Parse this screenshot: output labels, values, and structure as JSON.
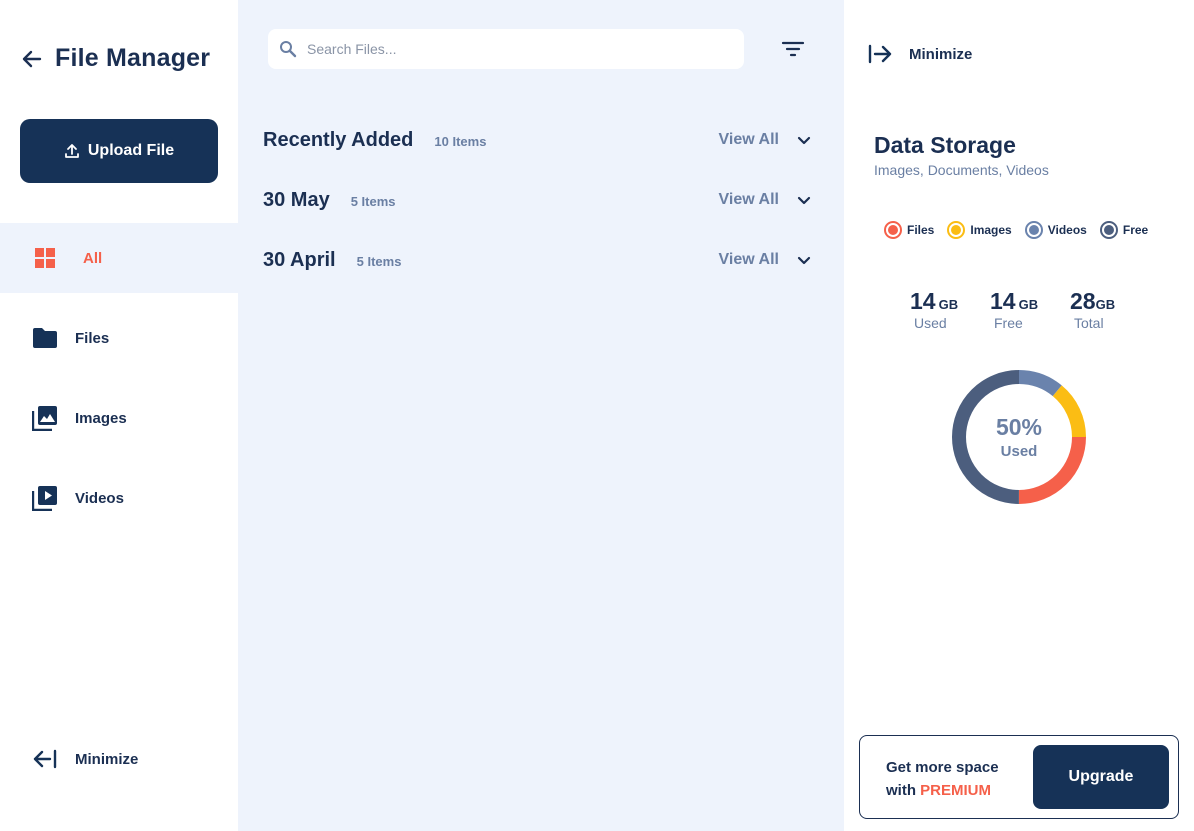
{
  "sidebar": {
    "title": "File Manager",
    "upload_label": "Upload File",
    "items": [
      {
        "label": "All",
        "icon": "grid-icon",
        "active": true
      },
      {
        "label": "Files",
        "icon": "folder-icon",
        "active": false
      },
      {
        "label": "Images",
        "icon": "images-icon",
        "active": false
      },
      {
        "label": "Videos",
        "icon": "video-library-icon",
        "active": false
      }
    ],
    "minimize_label": "Minimize"
  },
  "main": {
    "search_placeholder": "Search Files...",
    "sections": [
      {
        "title": "Recently Added",
        "count": "10 Items",
        "view_all": "View All"
      },
      {
        "title": "30 May",
        "count": "5 Items",
        "view_all": "View All"
      },
      {
        "title": "30 April",
        "count": "5 Items",
        "view_all": "View All"
      }
    ]
  },
  "right_panel": {
    "minimize_label": "Minimize",
    "storage_title": "Data Storage",
    "storage_subtitle": "Images, Documents, Videos",
    "legend": [
      {
        "label": "Files",
        "color": "#f5604a"
      },
      {
        "label": "Images",
        "color": "#fbbd14"
      },
      {
        "label": "Videos",
        "color": "#6a83ad"
      },
      {
        "label": "Free",
        "color": "#4c5e7e"
      }
    ],
    "stats": [
      {
        "value": "14",
        "unit": "GB",
        "caption": "Used"
      },
      {
        "value": "14",
        "unit": "GB",
        "caption": "Free"
      },
      {
        "value": "28",
        "unit": "GB",
        "caption": "Total"
      }
    ],
    "donut": {
      "percent_label": "50%",
      "caption": "Used",
      "segments": [
        {
          "name": "Videos",
          "fraction": 0.11,
          "color": "#6a83ad"
        },
        {
          "name": "Images",
          "fraction": 0.14,
          "color": "#fbbd14"
        },
        {
          "name": "Files",
          "fraction": 0.25,
          "color": "#f5604a"
        },
        {
          "name": "Free",
          "fraction": 0.5,
          "color": "#4c5e7e"
        }
      ]
    },
    "premium": {
      "line1": "Get more space",
      "line2_prefix": "with ",
      "line2_highlight": "PREMIUM",
      "upgrade_label": "Upgrade"
    }
  },
  "colors": {
    "accent": "#f5604a",
    "primary": "#163257",
    "background": "#eef3fc",
    "muted": "#6a7fa3"
  }
}
